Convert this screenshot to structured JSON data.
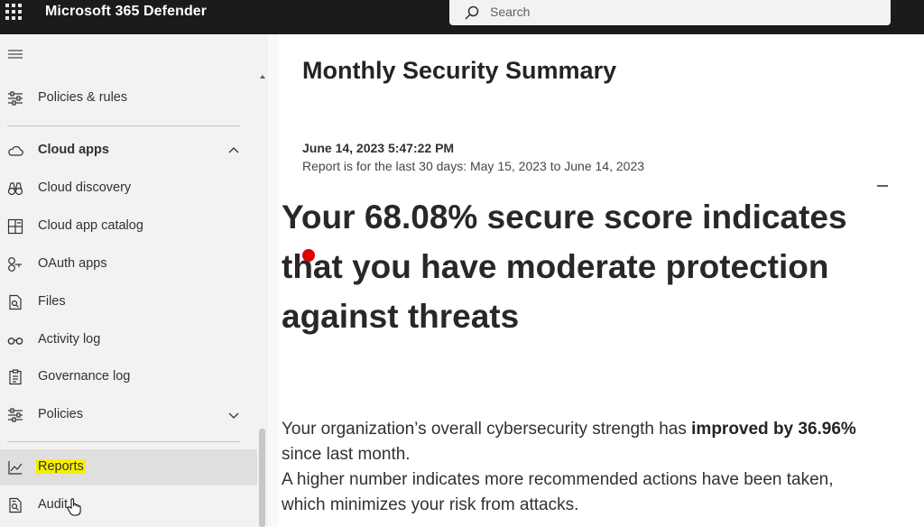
{
  "topbar": {
    "app_title": "Microsoft 365 Defender",
    "search_placeholder": "Search"
  },
  "sidebar": {
    "items": [
      {
        "label": "Policies & rules",
        "icon": "sliders-icon"
      },
      {
        "label": "Cloud apps",
        "icon": "cloud-icon",
        "expanded": true
      },
      {
        "label": "Cloud discovery",
        "icon": "binoculars-icon"
      },
      {
        "label": "Cloud app catalog",
        "icon": "catalog-icon"
      },
      {
        "label": "OAuth apps",
        "icon": "oauth-icon"
      },
      {
        "label": "Files",
        "icon": "file-search-icon"
      },
      {
        "label": "Activity log",
        "icon": "glasses-icon"
      },
      {
        "label": "Governance log",
        "icon": "clipboard-icon"
      },
      {
        "label": "Policies",
        "icon": "sliders-icon",
        "expanded": false
      },
      {
        "label": "Reports",
        "icon": "chart-line-icon",
        "selected": true
      },
      {
        "label": "Audit",
        "icon": "audit-icon"
      }
    ]
  },
  "report": {
    "title": "Monthly Security Summary",
    "date": "June 14, 2023 5:47:22 PM",
    "range": "Report is for the last 30 days: May 15, 2023 to June 14, 2023",
    "headline_line1": "Your 68.08% secure score indicates",
    "headline_line2": "that you have moderate protection",
    "headline_line3": "against threats",
    "para1_prefix": "Your organization’s overall cybersecurity strength has ",
    "para1_bold": "improved by 36.96%",
    "para1_line2": "since last month.",
    "para2_line1": "A higher number indicates more recommended actions have been taken,",
    "para2_line2": "which minimizes your risk from attacks."
  },
  "colors": {
    "topbar_bg": "#1b1b1b",
    "sidebar_bg": "#f3f2f1",
    "selected_bg": "#e1dfdd",
    "highlight": "#f6f000",
    "pointer_dot": "#e00000"
  }
}
